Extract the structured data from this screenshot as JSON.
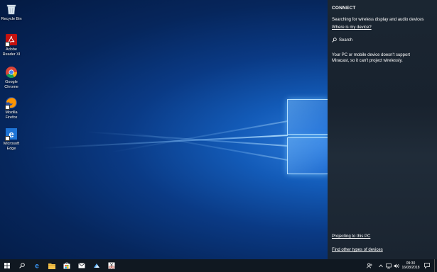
{
  "desktop": {
    "icons": [
      {
        "name": "recycle-bin",
        "label": "Recycle Bin"
      },
      {
        "name": "adobe-reader",
        "label": "Adobe\nReader XI"
      },
      {
        "name": "google-chrome",
        "label": "Google\nChrome"
      },
      {
        "name": "mozilla-firefox",
        "label": "Mozilla\nFirefox"
      },
      {
        "name": "microsoft-edge",
        "label": "Microsoft\nEdge"
      }
    ]
  },
  "connect_panel": {
    "title": "CONNECT",
    "status": "Searching for wireless display and audio devices",
    "where_link": "Where is my device?",
    "search_label": "Search",
    "miracast_message": "Your PC or mobile device doesn't support Miracast, so it can't project wirelessly.",
    "projecting_link": "Projecting to this PC",
    "other_devices_link": "Find other types of devices"
  },
  "taskbar": {
    "buttons": [
      "start-icon",
      "search-icon",
      "edge-icon",
      "file-explorer-icon",
      "store-icon",
      "mail-icon",
      "photos-icon",
      "snipping-tool-icon"
    ],
    "tray": {
      "time": "09:30",
      "date": "16/08/2018"
    }
  }
}
